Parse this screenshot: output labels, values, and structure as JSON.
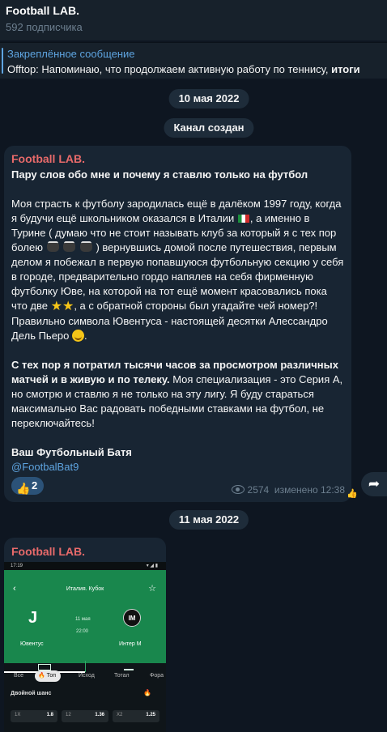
{
  "channel": {
    "title": "Football LAB.",
    "subscribers": "592 подписчика"
  },
  "pinned": {
    "title": "Закреплённое сообщение",
    "text": "Offtop:  Напоминаю, что продолжаем активную работу по теннису, ",
    "bold_tail": "итоги"
  },
  "service": {
    "date1": "10 мая 2022",
    "created": "Канал создан",
    "date2": "11 мая 2022"
  },
  "post1": {
    "author": "Football LAB.",
    "heading": "Пару слов обо мне и почему я ставлю только на футбол",
    "p1a": "Моя страсть к футболу зародилась ещё в далёком 1997 году, когда я будучи ещё школьником оказался в Италии ",
    "p1b": ", а именно в Турине ( думаю что не стоит называть клуб за который я с тех пор болею ",
    "p1c": " ) вернувшись домой после путешествия, первым делом я побежал в первую попавшуюся футбольную секцию у себя в городе, предварительно гордо напялев на себя фирменную футболку Юве, на которой на тот ещё момент красовались пока что  две ",
    "p1d": ", а с обратной стороны был угадайте чей номер?! Правильно символа Ювентуса - настоящей десятки Алессандро Дель Пьеро ",
    "p1e": ".",
    "p2_bold": "С тех пор я потратил тысячи часов за просмотром различных матчей и в живую и по телеку.",
    "p2_rest": " Моя специализация - это Серия А, но смотрю и ставлю я не только на эту лигу. Я буду стараться максимально Вас радовать победными ставками на футбол, не переключайтесь!",
    "sign": "Ваш Футбольный Батя",
    "link": "@FootbalBat9",
    "reaction_emoji": "👍",
    "reaction_count": "2",
    "views": "2574",
    "edited": "изменено 12:38"
  },
  "post2": {
    "author": "Football LAB.",
    "screenshot": {
      "time": "17:19",
      "status_right": "▾ ◢ ▮",
      "league": "Италия. Кубок",
      "team1": "Ювентус",
      "team2": "Интер М",
      "team2_abbr": "IM",
      "date": "11 мая",
      "kickoff": "22:00",
      "tabs": [
        "Все",
        "Топ",
        "Исход",
        "Тотал",
        "Фора"
      ],
      "section": "Двойной шанс",
      "odds": [
        {
          "k": "1X",
          "v": "1.8"
        },
        {
          "k": "12",
          "v": "1.36"
        },
        {
          "k": "X2",
          "v": "1.25"
        }
      ]
    }
  },
  "icons": {
    "share": "share-arrow-icon",
    "views": "eye-icon"
  }
}
